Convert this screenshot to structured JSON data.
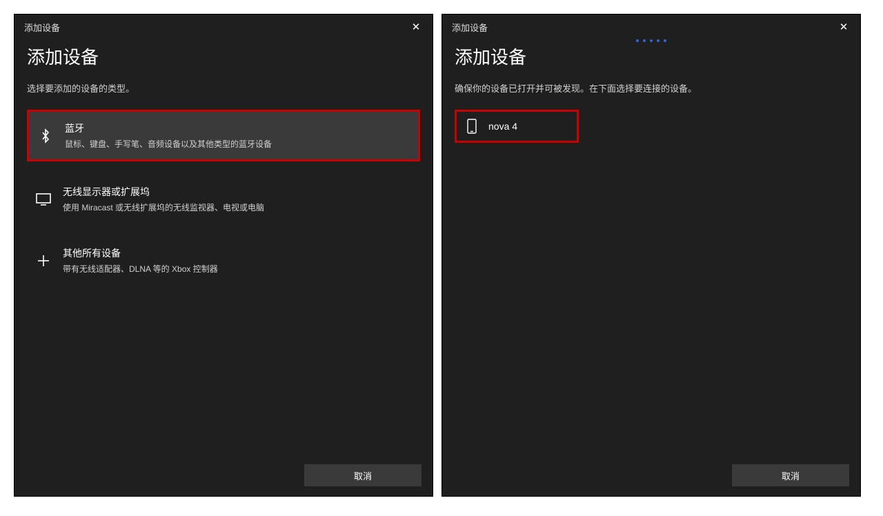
{
  "left": {
    "windowTitle": "添加设备",
    "heading": "添加设备",
    "subtext": "选择要添加的设备的类型。",
    "options": {
      "bluetooth": {
        "title": "蓝牙",
        "desc": "鼠标、键盘、手写笔、音频设备以及其他类型的蓝牙设备"
      },
      "wireless": {
        "title": "无线显示器或扩展坞",
        "desc": "使用 Miracast 或无线扩展坞的无线监视器、电视或电脑"
      },
      "other": {
        "title": "其他所有设备",
        "desc": "带有无线适配器、DLNA 等的 Xbox 控制器"
      }
    },
    "cancel": "取消"
  },
  "right": {
    "windowTitle": "添加设备",
    "heading": "添加设备",
    "subtext": "确保你的设备已打开并可被发现。在下面选择要连接的设备。",
    "device": {
      "name": "nova 4"
    },
    "cancel": "取消"
  }
}
